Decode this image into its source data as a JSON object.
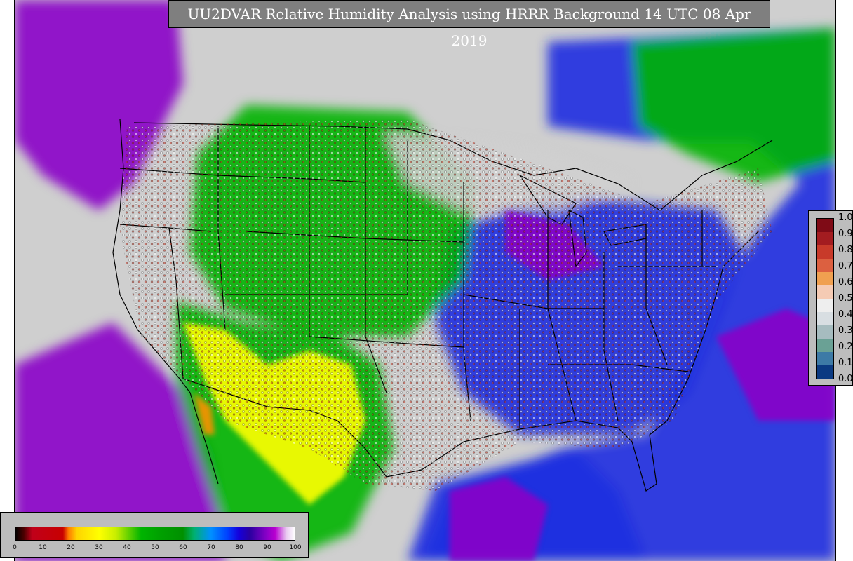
{
  "title": "UU2DVAR Relative Humidity Analysis using HRRR Background 14 UTC 08 Apr 2019",
  "map": {
    "region": "Contiguous United States",
    "variable": "Relative Humidity",
    "colors": {
      "ocean_dry": "#cfcfcf",
      "very_humid": "#8a00c8",
      "humid": "#1f2fe0",
      "moist": "#0080ff",
      "mid": "#00b400",
      "dry": "#ffff00",
      "very_dry": "#ff9000",
      "boundaries": "#000000"
    }
  },
  "rh_colorbar": {
    "ticks": [
      "0",
      "10",
      "20",
      "30",
      "40",
      "50",
      "60",
      "70",
      "80",
      "90",
      "100"
    ],
    "values": [
      0,
      10,
      20,
      30,
      40,
      50,
      60,
      70,
      80,
      90,
      100
    ]
  },
  "obs_colorbar": {
    "ticks": [
      "1.0",
      "0.9",
      "0.8",
      "0.7",
      "0.6",
      "0.5",
      "0.4",
      "0.3",
      "0.2",
      "0.1",
      "0.0"
    ],
    "values": [
      1.0,
      0.9,
      0.8,
      0.7,
      0.6,
      0.5,
      0.4,
      0.3,
      0.2,
      0.1,
      0.0
    ],
    "colors": [
      "#7f0b16",
      "#a31c20",
      "#c83a2a",
      "#dc6040",
      "#f0a050",
      "#f5cbb4",
      "#eeeeee",
      "#d8dee2",
      "#a6bcbf",
      "#6aa195",
      "#3d7aa6",
      "#0b3a82"
    ]
  }
}
